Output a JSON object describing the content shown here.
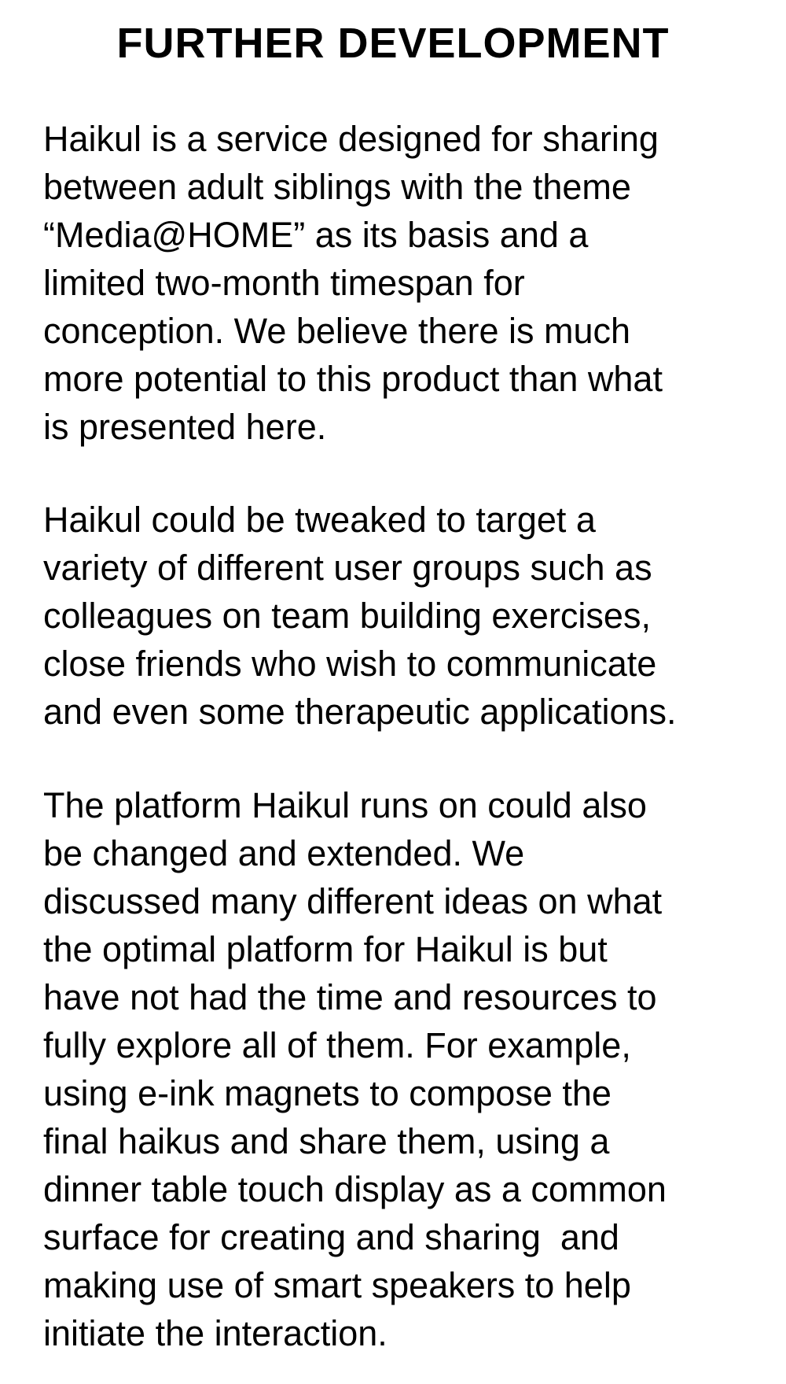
{
  "document": {
    "title": "FURTHER DEVELOPMENT",
    "paragraphs": [
      {
        "lines": [
          "Haikul is a service designed for sharing",
          "between adult siblings with the theme",
          "“Media@HOME” as its basis and a",
          "limited two-month timespan for",
          "conception. We believe there is much",
          "more potential to this product than what",
          "is presented here."
        ]
      },
      {
        "lines": [
          "Haikul could be tweaked to target a",
          "variety of different user groups such as",
          "colleagues on team building exercises,",
          "close friends who wish to communicate",
          "and even some therapeutic applications."
        ]
      },
      {
        "lines": [
          "The platform Haikul runs on could also",
          "be changed and extended. We",
          "discussed many different ideas on what",
          "the optimal platform for Haikul is but",
          "have not had the time and resources to",
          "fully explore all of them. For example,",
          "using e-ink magnets to compose the",
          "final haikus and share them, using a",
          "dinner table touch display as a common",
          "surface for creating and sharing  and",
          "making use of smart speakers to help",
          "initiate the interaction."
        ]
      }
    ]
  }
}
